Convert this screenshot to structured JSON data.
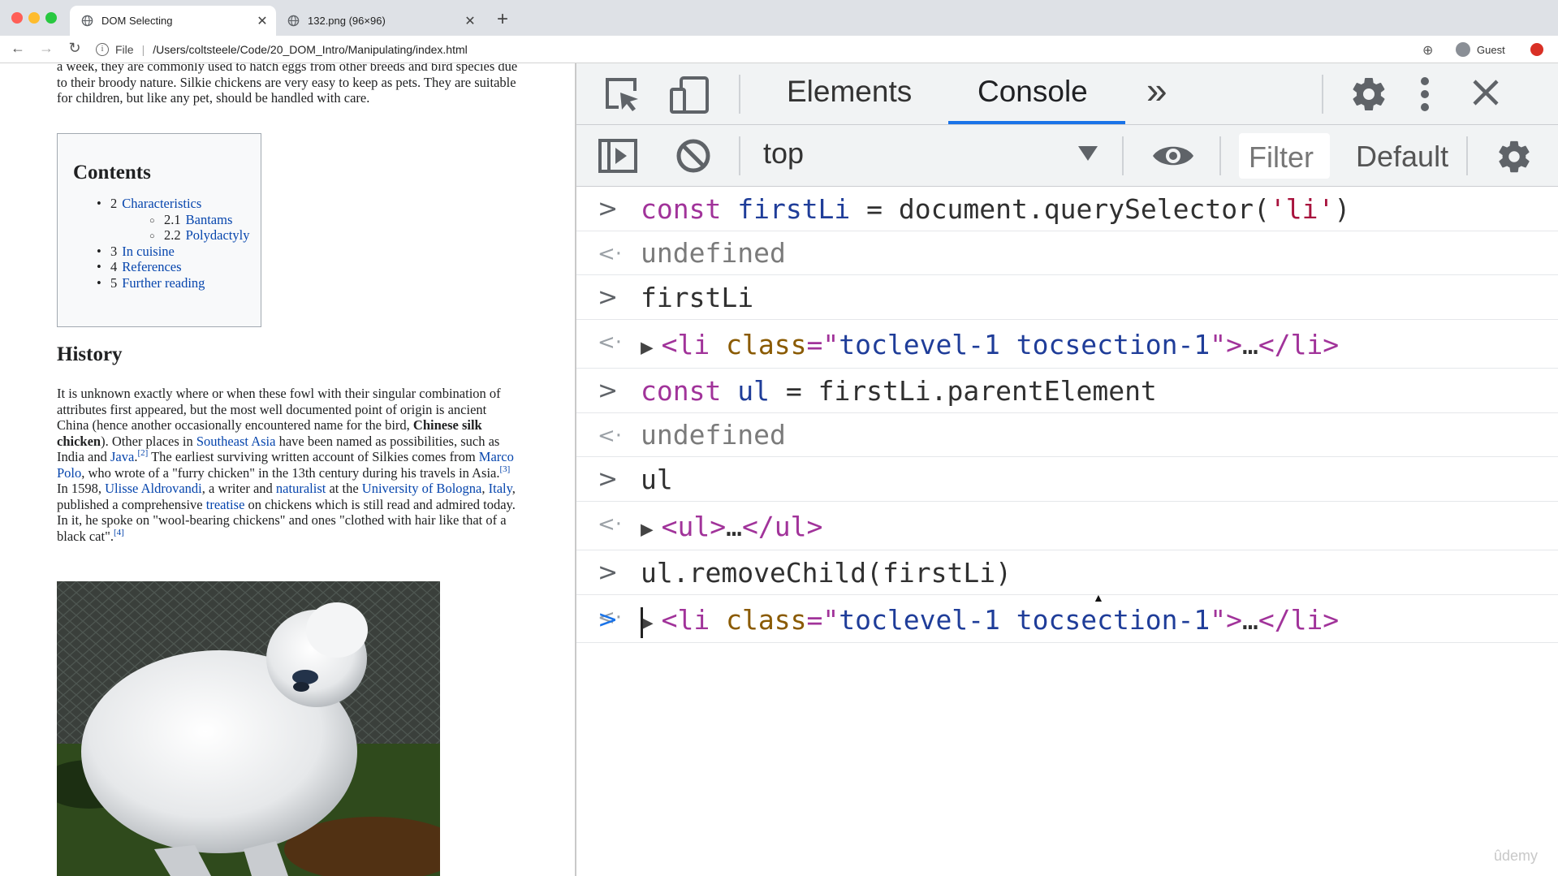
{
  "browser": {
    "tabs": [
      {
        "label": "DOM Selecting",
        "active": true
      },
      {
        "label": "132.png (96×96)",
        "active": false
      }
    ],
    "new_tab": "+",
    "address": {
      "scheme_label": "File",
      "url": "/Users/coltsteele/Code/20_DOM_Intro/Manipulating/index.html"
    },
    "profile": "Guest",
    "traffic_colors": [
      "#ff5f57",
      "#febc2e",
      "#28c840"
    ]
  },
  "page": {
    "intro": "a week, they are commonly used to hatch eggs from other breeds and bird species due to their broody nature. Silkie chickens are very easy to keep as pets. They are suitable for children, but like any pet, should be handled with care.",
    "toc": {
      "title": "Contents",
      "items": [
        {
          "num": "2",
          "label": "Characteristics",
          "level": 1
        },
        {
          "num": "2.1",
          "label": "Bantams",
          "level": 2
        },
        {
          "num": "2.2",
          "label": "Polydactyly",
          "level": 2
        },
        {
          "num": "3",
          "label": "In cuisine",
          "level": 1
        },
        {
          "num": "4",
          "label": "References",
          "level": 1
        },
        {
          "num": "5",
          "label": "Further reading",
          "level": 1
        }
      ]
    },
    "history_heading": "History",
    "history": {
      "t1": "It is unknown exactly where or when these fowl with their singular combination of attributes first appeared, but the most well documented point of origin is ancient China (hence another occasionally encountered name for the bird, ",
      "bold": "Chinese silk chicken",
      "t2": "). Other places in ",
      "l1": "Southeast Asia",
      "t3": " have been named as possibilities, such as India and ",
      "l2": "Java",
      "s1": "[2]",
      "t4": " The earliest surviving written account of Silkies comes from ",
      "l3": "Marco Polo",
      "t5": ", who wrote of a \"furry chicken\" in the 13th century during his travels in Asia.",
      "s2": "[3]",
      "t6": " In 1598, ",
      "l4": "Ulisse Aldrovandi",
      "t7": ", a writer and ",
      "l5": "naturalist",
      "t8": " at the ",
      "l6": "University of Bologna",
      "t9": ", ",
      "l7": "Italy",
      "t10": ", published a comprehensive ",
      "l8": "treatise",
      "t11": " on chickens which is still read and admired today. In it, he spoke on \"wool-bearing chickens\" and ones \"clothed with hair like that of a black cat\".",
      "s3": "[4]"
    }
  },
  "devtools": {
    "tabs": [
      "Elements",
      "Console"
    ],
    "active_tab": "Console",
    "more_tabs": "»",
    "context": "top",
    "filter_placeholder": "Filter",
    "levels": "Default levels",
    "accent": "#1a73e8",
    "console": {
      "r1": {
        "kw": "const",
        "name": "firstLi",
        "eq": " = ",
        "call": "document.querySelector(",
        "arg": "'li'",
        "close": ")"
      },
      "r2": "undefined",
      "r3": "firstLi",
      "r4": {
        "open": "<li",
        "attr": " class",
        "eq": "=\"",
        "val": "toclevel-1 tocsection-1",
        "end": "\">",
        "dots": "…",
        "close": "</li>"
      },
      "r5": {
        "kw": "const",
        "name": "ul",
        "eq": " = ",
        "expr": "firstLi.parentElement"
      },
      "r6": "undefined",
      "r7": "ul",
      "r8": {
        "open": "<ul>",
        "dots": "…",
        "close": "</ul>"
      },
      "r9": "ul.removeChild(firstLi)",
      "r10": {
        "open": "<li",
        "attr": " class",
        "eq": "=\"",
        "val": "toclevel-1 tocsection-1",
        "end": "\">",
        "dots": "…",
        "close": "</li>"
      }
    }
  },
  "watermark": "ûdemy"
}
